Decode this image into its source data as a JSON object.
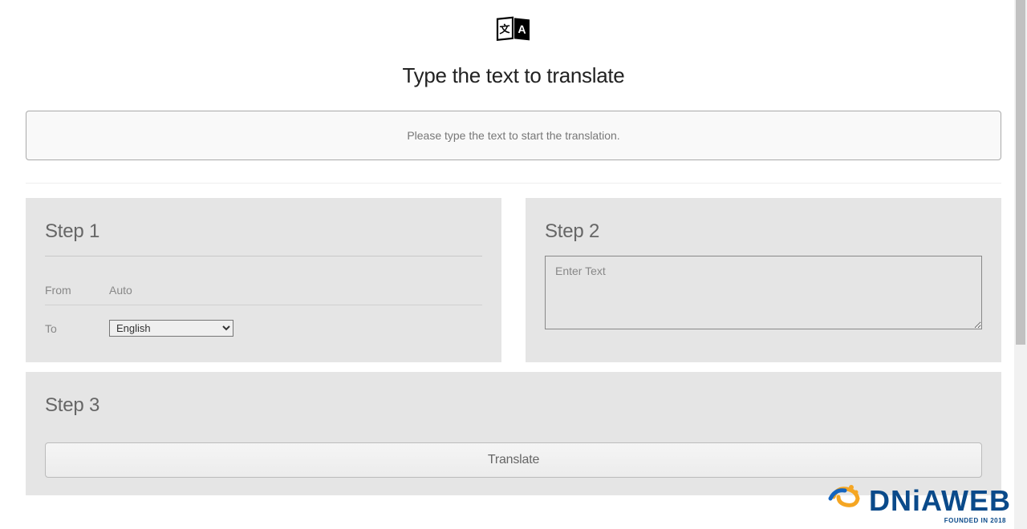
{
  "header": {
    "title": "Type the text to translate"
  },
  "notice": {
    "text": "Please type the text to start the translation."
  },
  "step1": {
    "heading": "Step 1",
    "from_label": "From",
    "from_value": "Auto",
    "to_label": "To",
    "to_selected": "English"
  },
  "step2": {
    "heading": "Step 2",
    "textarea_placeholder": "Enter Text"
  },
  "step3": {
    "heading": "Step 3",
    "button_label": "Translate"
  },
  "watermark": {
    "brand": "DNiAWEB",
    "tagline": "FOUNDED IN 2018"
  }
}
